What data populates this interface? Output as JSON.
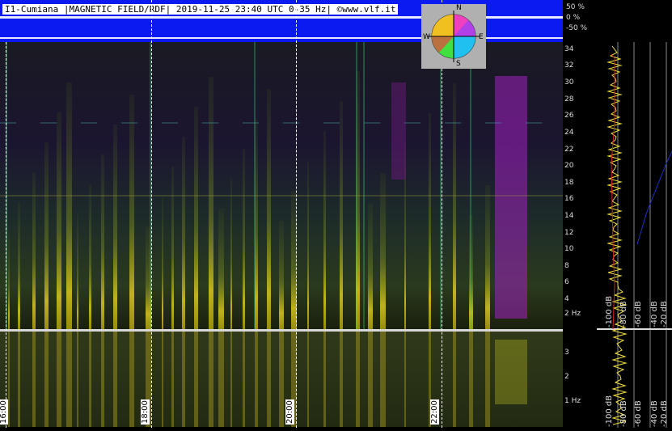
{
  "header": {
    "title": "I1-Cumiana |MAGNETIC FIELD/RDF| 2019-11-25 23:40 UTC 0-35 Hz| ©www.vlf.it",
    "percent_labels": [
      "50 %",
      "0 %",
      "-50 %"
    ]
  },
  "compass": {
    "n": "N",
    "s": "S",
    "e": "E",
    "w": "W"
  },
  "spectrogram_top": {
    "freq_labels": [
      "34",
      "32",
      "30",
      "28",
      "26",
      "24",
      "22",
      "20",
      "18",
      "16",
      "14",
      "12",
      "10",
      "8",
      "6",
      "4",
      "2 Hz"
    ]
  },
  "spectrogram_bottom": {
    "freq_labels": [
      "3",
      "2",
      "1 Hz"
    ]
  },
  "time_labels": [
    "16:00",
    "18:00",
    "20:00",
    "22:00"
  ],
  "db_labels_top": [
    "-100 dB",
    "-80 dB",
    "-60 dB",
    "-40 dB",
    "-20 dB"
  ],
  "db_labels_bottom": [
    "-100 dB",
    "-80 dB",
    "-60 dB",
    "-40 dB",
    "-20 dB"
  ],
  "colors": {
    "blue_bar": "#0a1af0",
    "background": "#000000"
  }
}
